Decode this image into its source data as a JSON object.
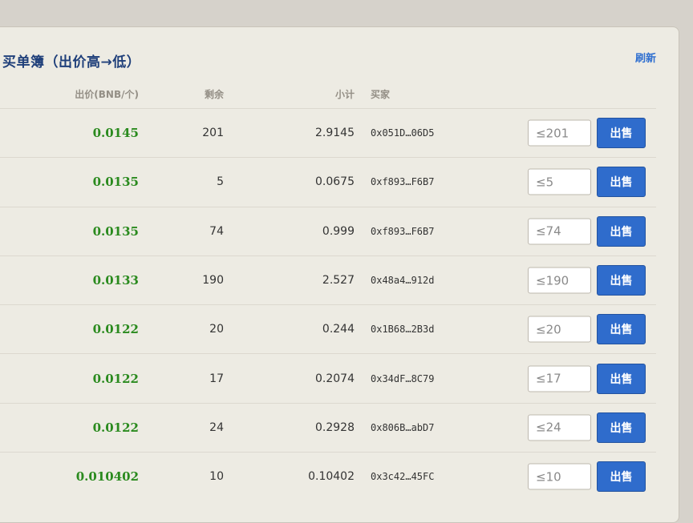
{
  "section": {
    "title": "买单簿（出价高→低）",
    "refresh_label": "刷新"
  },
  "columns": {
    "price": "出价(BNB/个)",
    "remaining": "剩余",
    "subtotal": "小计",
    "buyer": "买家"
  },
  "rows": [
    {
      "price": "0.0145",
      "remaining": "201",
      "subtotal": "2.9145",
      "buyer": "0x051D…06D5",
      "input_placeholder": "≤201",
      "sell_label": "出售"
    },
    {
      "price": "0.0135",
      "remaining": "5",
      "subtotal": "0.0675",
      "buyer": "0xf893…F6B7",
      "input_placeholder": "≤5",
      "sell_label": "出售"
    },
    {
      "price": "0.0135",
      "remaining": "74",
      "subtotal": "0.999",
      "buyer": "0xf893…F6B7",
      "input_placeholder": "≤74",
      "sell_label": "出售"
    },
    {
      "price": "0.0133",
      "remaining": "190",
      "subtotal": "2.527",
      "buyer": "0x48a4…912d",
      "input_placeholder": "≤190",
      "sell_label": "出售"
    },
    {
      "price": "0.0122",
      "remaining": "20",
      "subtotal": "0.244",
      "buyer": "0x1B68…2B3d",
      "input_placeholder": "≤20",
      "sell_label": "出售"
    },
    {
      "price": "0.0122",
      "remaining": "17",
      "subtotal": "0.2074",
      "buyer": "0x34dF…8C79",
      "input_placeholder": "≤17",
      "sell_label": "出售"
    },
    {
      "price": "0.0122",
      "remaining": "24",
      "subtotal": "0.2928",
      "buyer": "0x806B…abD7",
      "input_placeholder": "≤24",
      "sell_label": "出售"
    },
    {
      "price": "0.010402",
      "remaining": "10",
      "subtotal": "0.10402",
      "buyer": "0x3c42…45FC",
      "input_placeholder": "≤10",
      "sell_label": "出售"
    }
  ]
}
